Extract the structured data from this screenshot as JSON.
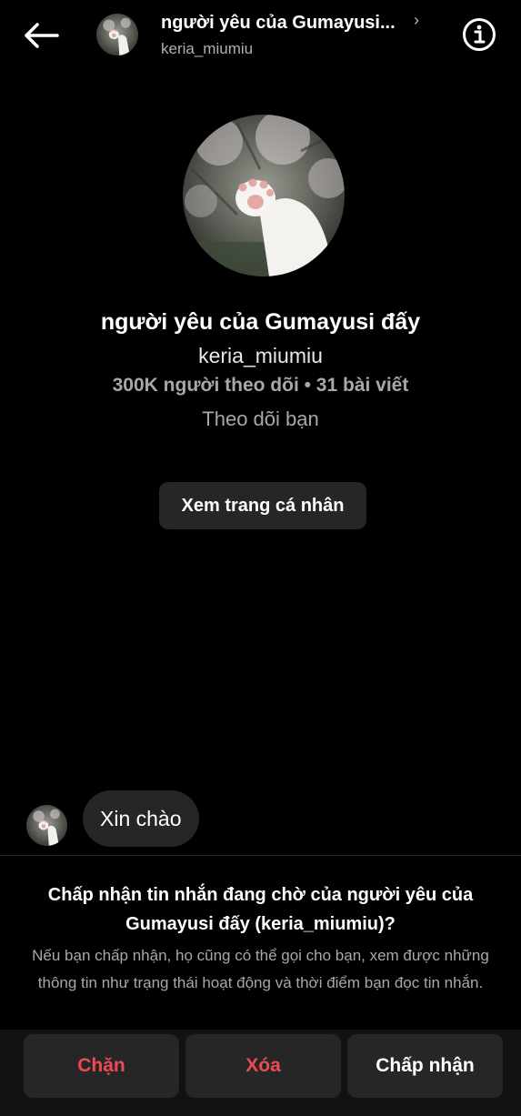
{
  "header": {
    "back_icon": "arrow-left-icon",
    "title": "người yêu của Gumayusi...",
    "chevron": "›",
    "username": "keria_miumiu",
    "info_icon": "info-icon"
  },
  "profile": {
    "name": "người yêu của Gumayusi đấy",
    "username": "keria_miumiu",
    "stats": "300K người theo dõi • 31 bài viết",
    "follow_status": "Theo dõi bạn",
    "view_profile_label": "Xem trang cá nhân"
  },
  "messages": [
    {
      "text": "Xin chào"
    }
  ],
  "request": {
    "title_prefix": "Chấp nhận tin nhắn đang chờ của ",
    "title_name": "người yêu của Gumayusi đấy (keria_miumiu)",
    "title_suffix": "?",
    "description": "Nếu bạn chấp nhận, họ cũng có thể gọi cho bạn, xem được những thông tin như trạng thái hoạt động và thời điểm bạn đọc tin nhắn."
  },
  "actions": {
    "block_label": "Chặn",
    "delete_label": "Xóa",
    "accept_label": "Chấp nhận"
  },
  "colors": {
    "background": "#000000",
    "surface": "#262626",
    "danger": "#ed4956",
    "muted_text": "#a8a8a8"
  }
}
